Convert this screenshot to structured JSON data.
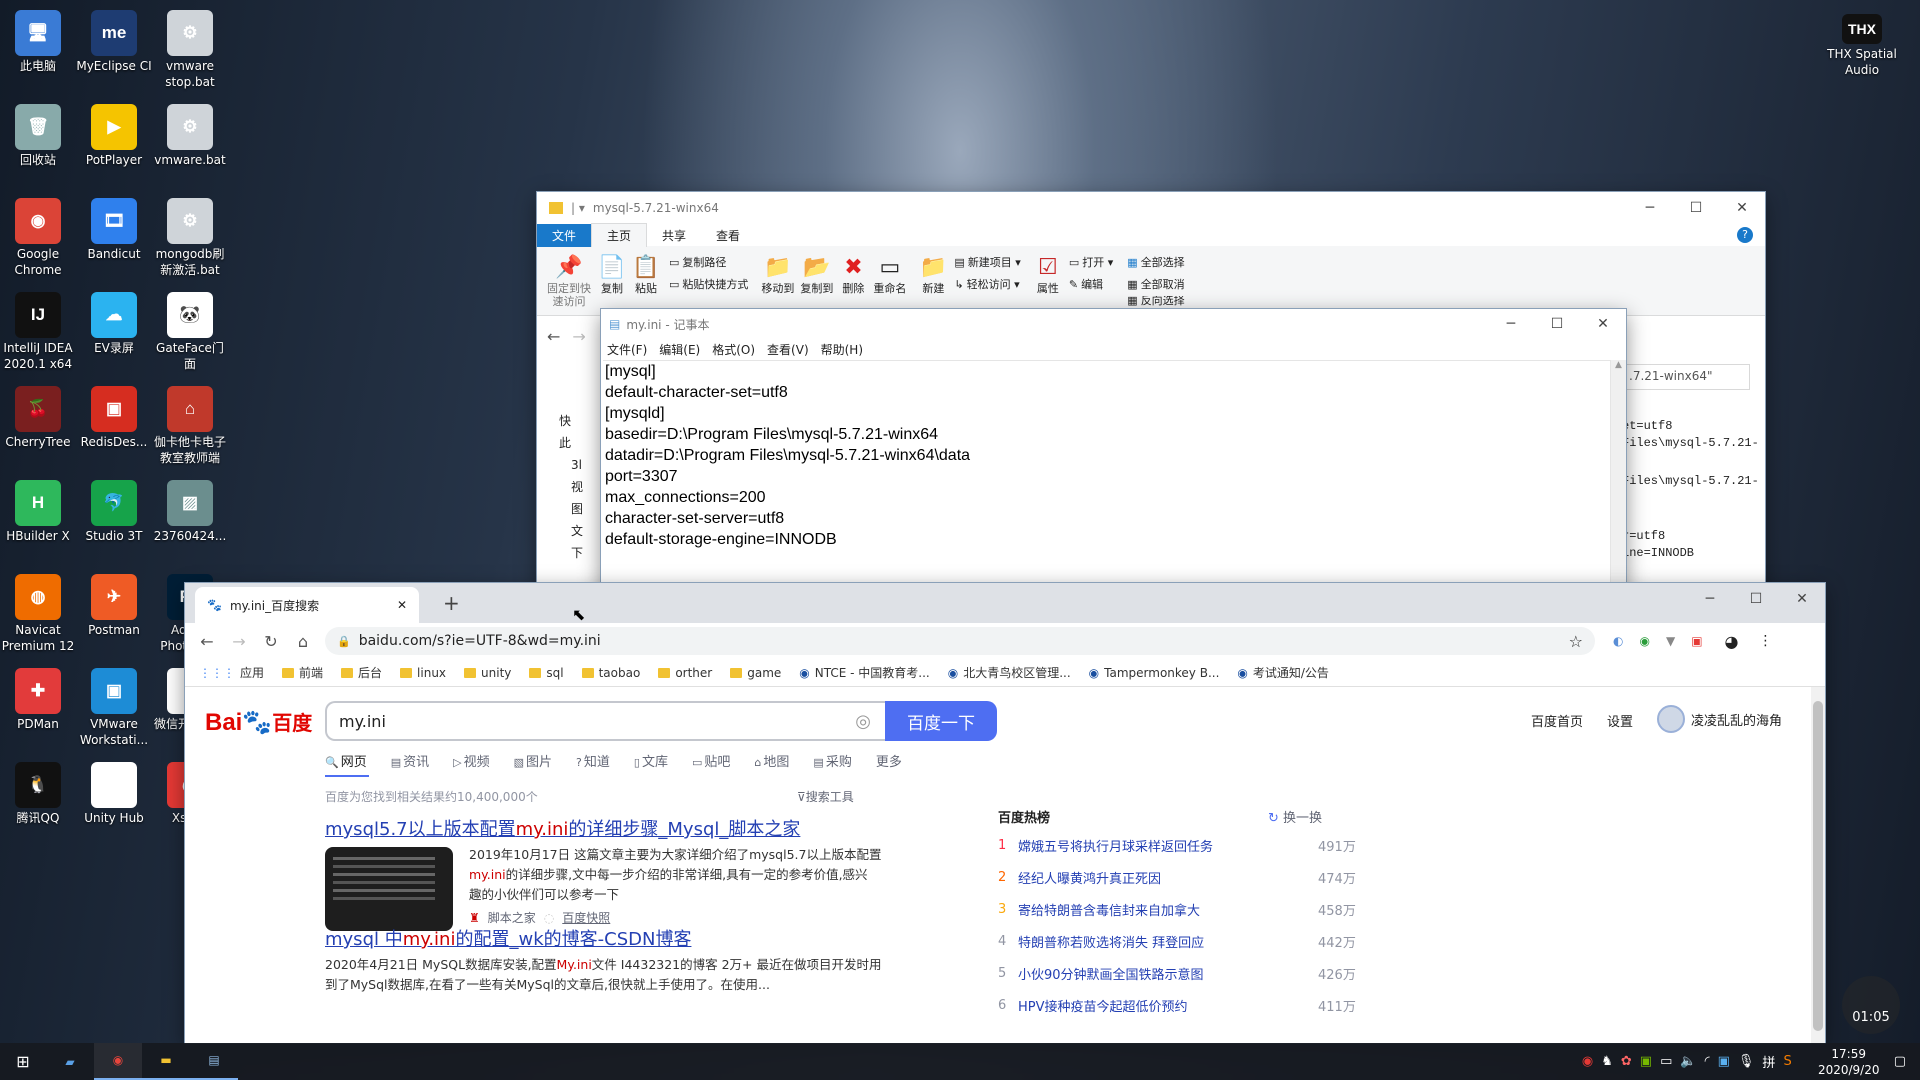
{
  "desktop": {
    "icons": [
      {
        "label": "此电脑",
        "glyph": "🖥",
        "color": "#3a7bd5"
      },
      {
        "label": "MyEclipse CI",
        "glyph": "me",
        "color": "#1e3c72"
      },
      {
        "label": "vmware stop.bat",
        "glyph": "⚙",
        "color": "#cfd4d9"
      },
      {
        "label": "回收站",
        "glyph": "🗑",
        "color": "#8aa"
      },
      {
        "label": "PotPlayer",
        "glyph": "▶",
        "color": "#f5c400"
      },
      {
        "label": "vmware.bat",
        "glyph": "⚙",
        "color": "#cfd4d9"
      },
      {
        "label": "Google Chrome",
        "glyph": "◉",
        "color": "#db4437"
      },
      {
        "label": "Bandicut",
        "glyph": "🎞",
        "color": "#2f80ed"
      },
      {
        "label": "mongodb刷新激活.bat",
        "glyph": "⚙",
        "color": "#cfd4d9"
      },
      {
        "label": "IntelliJ IDEA 2020.1 x64",
        "glyph": "IJ",
        "color": "#111"
      },
      {
        "label": "EV录屏",
        "glyph": "☁",
        "color": "#2bb3f0"
      },
      {
        "label": "GateFace门面",
        "glyph": "🐼",
        "color": "#fff"
      },
      {
        "label": "CherryTree",
        "glyph": "🍒",
        "color": "#7a1f1f"
      },
      {
        "label": "RedisDes...",
        "glyph": "▣",
        "color": "#d62d20"
      },
      {
        "label": "伽卡他卡电子教室教师端",
        "glyph": "⌂",
        "color": "#c0392b"
      },
      {
        "label": "HBuilder X",
        "glyph": "H",
        "color": "#2eb85c"
      },
      {
        "label": "Studio 3T",
        "glyph": "🐬",
        "color": "#16a34a"
      },
      {
        "label": "23760424...",
        "glyph": "▨",
        "color": "#6b8e8e"
      },
      {
        "label": "Navicat Premium 12",
        "glyph": "◍",
        "color": "#ef6c00"
      },
      {
        "label": "Postman",
        "glyph": "✈",
        "color": "#ef5b25"
      },
      {
        "label": "Adobe Photosh...",
        "glyph": "Ps",
        "color": "#001e36"
      },
      {
        "label": "PDMan",
        "glyph": "✚",
        "color": "#e23b3b"
      },
      {
        "label": "VMware Workstati...",
        "glyph": "▣",
        "color": "#1d8cd6"
      },
      {
        "label": "微信开发者工具",
        "glyph": "〰",
        "color": "#fff"
      },
      {
        "label": "腾讯QQ",
        "glyph": "🐧",
        "color": "#111"
      },
      {
        "label": "Unity Hub",
        "glyph": "◇",
        "color": "#fff"
      },
      {
        "label": "Xshell",
        "glyph": "@",
        "color": "#e53935"
      }
    ],
    "right_icon": {
      "label": "THX Spatial Audio",
      "glyph": "THX"
    }
  },
  "explorer": {
    "title": "mysql-5.7.21-winx64",
    "tabs": [
      "文件",
      "主页",
      "共享",
      "查看"
    ],
    "groups": [
      {
        "label": "固定到快速访问",
        "glyph": "📌"
      },
      {
        "label": "复制",
        "glyph": "📄"
      },
      {
        "label": "粘贴",
        "glyph": "📋"
      },
      {
        "label": "移动到",
        "glyph": "📁"
      },
      {
        "label": "复制到",
        "glyph": "📂"
      },
      {
        "label": "删除",
        "glyph": "✖"
      },
      {
        "label": "重命名",
        "glyph": "▭"
      },
      {
        "label": "新建",
        "glyph": "📁"
      },
      {
        "label": "属性",
        "glyph": "☑"
      }
    ],
    "small": {
      "copy_path": "复制路径",
      "paste_shortcut": "粘贴快捷方式",
      "new_item": "新建项目 ▾",
      "easy_access": "轻松访问 ▾",
      "open": "打开 ▾",
      "edit": "编辑",
      "select_all": "全部选择",
      "select_none": "全部取消",
      "invert": "反向选择"
    },
    "address": ".7.21-winx64\"",
    "nav_items": [
      "快",
      "此",
      "3l",
      "视",
      "图",
      "文",
      "下"
    ],
    "preview": [
      "et=utf8",
      "Files\\mysql-5.7.21-",
      "Files\\mysql-5.7.21-",
      "",
      "r=utf8",
      "ine=INNODB"
    ]
  },
  "notepad": {
    "title": "my.ini - 记事本",
    "menu": [
      "文件(F)",
      "编辑(E)",
      "格式(O)",
      "查看(V)",
      "帮助(H)"
    ],
    "lines": [
      "[mysql]",
      "default-character-set=utf8",
      "[mysqld]",
      "basedir=D:\\Program Files\\mysql-5.7.21-winx64",
      "datadir=D:\\Program Files\\mysql-5.7.21-winx64\\data",
      "port=3307",
      "max_connections=200",
      "character-set-server=utf8",
      "default-storage-engine=INNODB"
    ]
  },
  "chrome": {
    "tab_title": "my.ini_百度搜索",
    "url": "baidu.com/s?ie=UTF-8&wd=my.ini",
    "bookmarks": [
      {
        "label": "应用",
        "type": "apps"
      },
      {
        "label": "前端",
        "type": "folder"
      },
      {
        "label": "后台",
        "type": "folder"
      },
      {
        "label": "linux",
        "type": "folder"
      },
      {
        "label": "unity",
        "type": "folder"
      },
      {
        "label": "sql",
        "type": "folder"
      },
      {
        "label": "taobao",
        "type": "folder"
      },
      {
        "label": "orther",
        "type": "folder"
      },
      {
        "label": "game",
        "type": "folder"
      },
      {
        "label": "NTCE - 中国教育考...",
        "type": "site"
      },
      {
        "label": "北大青鸟校区管理...",
        "type": "site"
      },
      {
        "label": "Tampermonkey B...",
        "type": "site"
      },
      {
        "label": "考试通知/公告",
        "type": "site"
      }
    ]
  },
  "baidu": {
    "logo_a": "Bai",
    "logo_b": "百度",
    "query": "my.ini",
    "search_button": "百度一下",
    "top_links": [
      "百度首页",
      "设置"
    ],
    "username": "凌凌乱乱的海角",
    "tabs": [
      "网页",
      "资讯",
      "视频",
      "图片",
      "知道",
      "文库",
      "贴吧",
      "地图",
      "采购",
      "更多"
    ],
    "result_count": "百度为您找到相关结果约10,400,000个",
    "search_tools": "搜索工具",
    "results": [
      {
        "title_a": "mysql5.7以上版本配置",
        "title_hl": "my.ini",
        "title_b": "的详细步骤_Mysql_脚本之家",
        "line1": "2019年10月17日 这篇文章主要为大家详细介绍了mysql5.7以上版本配置",
        "line2_hl": "my.ini",
        "line2": "的详细步骤,文中每一步介绍的非常详细,具有一定的参考价值,感兴",
        "line3": "趣的小伙伴们可以参考一下",
        "source": "脚本之家",
        "cache": "百度快照"
      },
      {
        "title_a": "mysql 中",
        "title_hl": "my.ini",
        "title_b": "的配置_wk的博客-CSDN博客",
        "line1_a": "2020年4月21日 MySQL数据库安装,配置",
        "line1_hl": "My.ini",
        "line1_b": "文件 I4432321的博客 2万+ 最近在做项目开发时用",
        "line2": "到了MySql数据库,在看了一些有关MySql的文章后,很快就上手使用了。在使用..."
      }
    ],
    "hot": {
      "title": "百度热榜",
      "refresh": "换一换",
      "items": [
        {
          "n": "1",
          "t": "嫦娥五号将执行月球采样返回任务",
          "h": "491万"
        },
        {
          "n": "2",
          "t": "经纪人曝黄鸿升真正死因",
          "h": "474万"
        },
        {
          "n": "3",
          "t": "寄给特朗普含毒信封来自加拿大",
          "h": "458万"
        },
        {
          "n": "4",
          "t": "特朗普称若败选将消失 拜登回应",
          "h": "442万"
        },
        {
          "n": "5",
          "t": "小伙90分钟默画全国铁路示意图",
          "h": "426万"
        },
        {
          "n": "6",
          "t": "HPV接种疫苗今起超低价预约",
          "h": "411万"
        }
      ]
    }
  },
  "taskbar": {
    "time": "17:59",
    "date": "2020/9/20",
    "overlay_time": "01:05"
  }
}
